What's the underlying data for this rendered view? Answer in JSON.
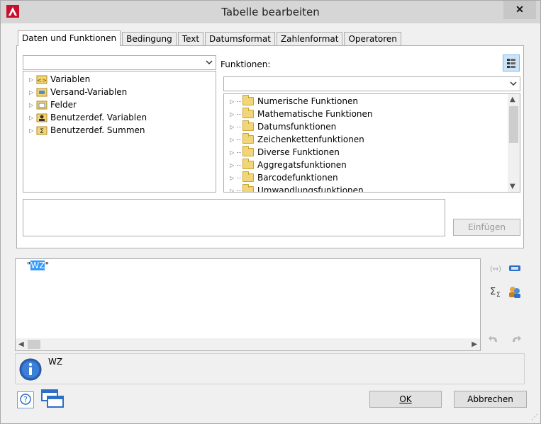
{
  "window": {
    "title": "Tabelle bearbeiten",
    "close_glyph": "✕"
  },
  "tabs": [
    {
      "label": "Daten und Funktionen",
      "active": true
    },
    {
      "label": "Bedingung",
      "active": false
    },
    {
      "label": "Text",
      "active": false
    },
    {
      "label": "Datumsformat",
      "active": false
    },
    {
      "label": "Zahlenformat",
      "active": false
    },
    {
      "label": "Operatoren",
      "active": false
    }
  ],
  "left_tree": {
    "combo_value": "",
    "items": [
      {
        "label": "Variablen",
        "icon": "variables-icon"
      },
      {
        "label": "Versand-Variablen",
        "icon": "shipping-variables-icon"
      },
      {
        "label": "Felder",
        "icon": "fields-icon"
      },
      {
        "label": "Benutzerdef. Variablen",
        "icon": "user-variables-icon"
      },
      {
        "label": "Benutzerdef. Summen",
        "icon": "user-sums-icon"
      }
    ]
  },
  "functions": {
    "label": "Funktionen:",
    "combo_value": "",
    "items": [
      "Numerische Funktionen",
      "Mathematische Funktionen",
      "Datumsfunktionen",
      "Zeichenkettenfunktionen",
      "Diverse Funktionen",
      "Aggregatsfunktionen",
      "Barcodefunktionen",
      "Umwandlungsfunktionen"
    ]
  },
  "description_text": "",
  "insert_button": "Einfügen",
  "expression": {
    "prefix": " \"",
    "selected": "WZ",
    "suffix": "\""
  },
  "info": {
    "text": "WZ"
  },
  "buttons": {
    "ok": "OK",
    "cancel": "Abbrechen"
  },
  "colors": {
    "accent": "#3390ff",
    "selection": "#3399ff",
    "info_blue": "#2a64b8"
  }
}
